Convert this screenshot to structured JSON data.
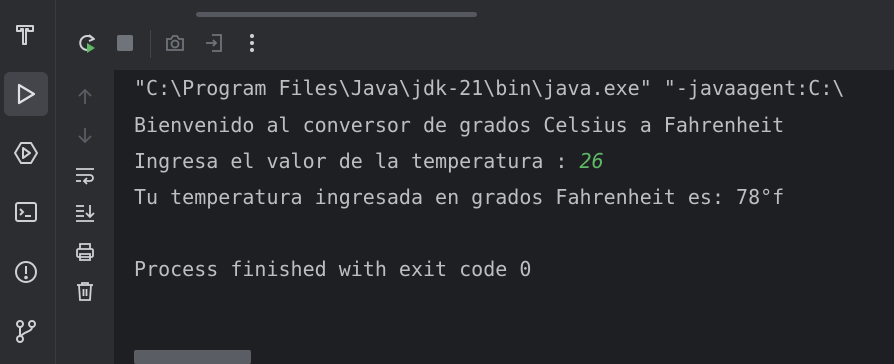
{
  "icons": {
    "left_bar": [
      "hammer-icon",
      "run-icon",
      "services-icon",
      "terminal-icon",
      "problems-icon",
      "git-icon"
    ],
    "toolbar": [
      "rerun-icon",
      "stop-icon",
      "camera-icon",
      "exit-icon",
      "more-icon"
    ],
    "side_tools": [
      "up-arrow-icon",
      "down-arrow-icon",
      "soft-wrap-icon",
      "scroll-to-end-icon",
      "print-icon",
      "trash-icon"
    ]
  },
  "colors": {
    "background": "#1e1f22",
    "panel": "#2b2d30",
    "text": "#bcbec4",
    "input": "#5fb865",
    "run_green": "#5fb865"
  },
  "console": {
    "line1": "\"C:\\Program Files\\Java\\jdk-21\\bin\\java.exe\" \"-javaagent:C:\\",
    "line2": "Bienvenido al conversor de grados Celsius a Fahrenheit",
    "line3_prompt": "Ingresa el valor de la temperatura : ",
    "line3_input": "26",
    "line4": "Tu temperatura ingresada en grados Fahrenheit es: 78°f",
    "line5": "Process finished with exit code 0"
  }
}
